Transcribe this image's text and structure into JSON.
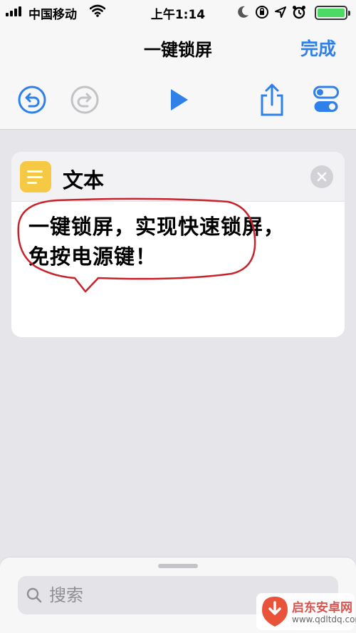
{
  "status_bar": {
    "carrier": "中国移动",
    "time": "上午1:14",
    "battery_level": 1.0,
    "battery_color": "#4cd964"
  },
  "nav": {
    "title": "一键锁屏",
    "done_label": "完成",
    "accent_color": "#2f80e8"
  },
  "toolbar": {
    "icons": [
      "undo-icon",
      "redo-icon",
      "play-icon",
      "share-icon",
      "settings-toggle-icon"
    ]
  },
  "action_card": {
    "title": "文本",
    "icon": "text-lines-icon",
    "icon_color": "#f6c945",
    "text_line1": "一键锁屏，实现快速锁屏，",
    "text_line2": "免按电源键！"
  },
  "bottom_sheet": {
    "search_placeholder": "搜索"
  },
  "watermark": {
    "name": "启东安卓网",
    "url": "www.qdltdq.com"
  }
}
